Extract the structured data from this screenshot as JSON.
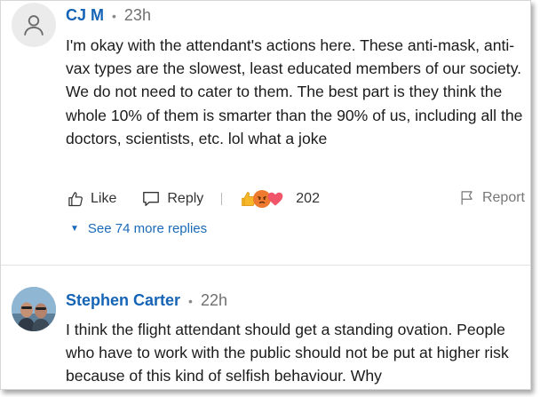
{
  "comments": [
    {
      "author": "CJ M",
      "time": "23h",
      "separator": "•",
      "text": "I'm okay with the attendant's actions here.  These anti-mask, anti-vax types are the slowest, least educated members of our society.  We do not need to cater to them.  The best part is they think the whole 10% of them is smarter than the 90% of us, including all the doctors, scientists, etc.  lol what a joke",
      "actions": {
        "like_label": "Like",
        "reply_label": "Reply",
        "report_label": "Report",
        "reaction_count": "202",
        "reaction_icons": [
          "thumbs-up-icon",
          "angry-face-icon",
          "heart-icon"
        ]
      },
      "more_replies_label": "See 74 more replies"
    },
    {
      "author": "Stephen Carter",
      "time": "22h",
      "separator": "•",
      "text": "I think the flight attendant should get a standing ovation.  People who have to work with the public should not be put at higher risk because of this kind of selfish behaviour. Why"
    }
  ],
  "colors": {
    "author_link": "#1564b6",
    "more_link": "#1a6ab8",
    "text": "#1b1b1b",
    "muted": "#707070"
  }
}
